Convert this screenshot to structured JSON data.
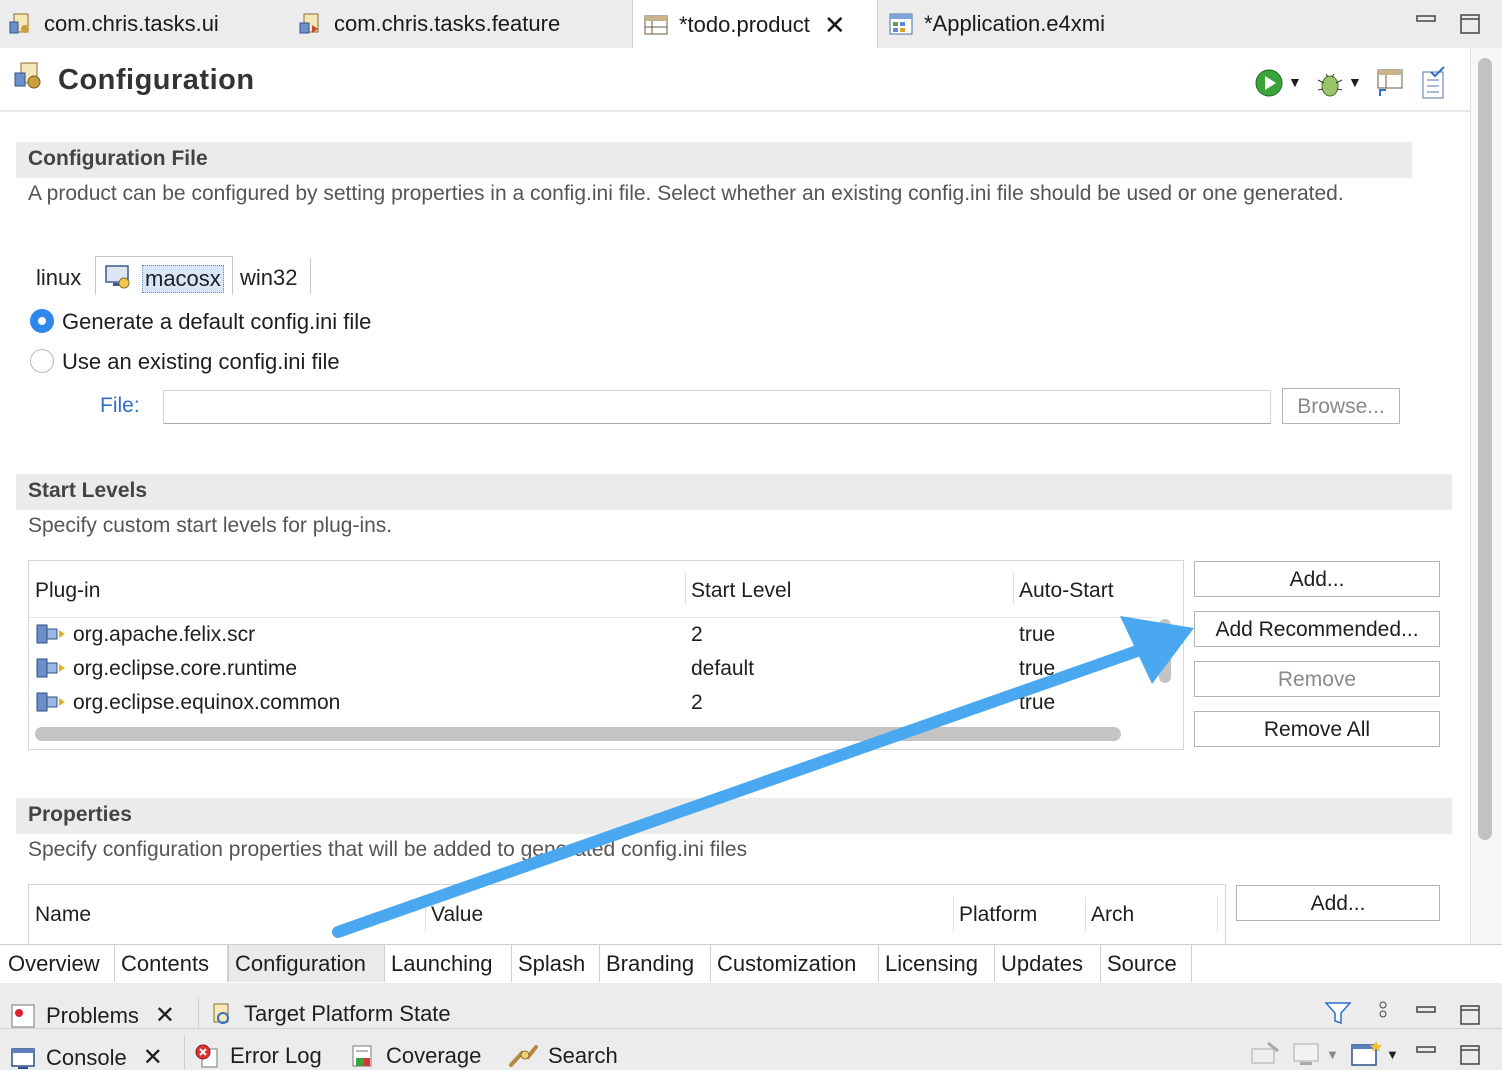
{
  "editor_tabs": [
    {
      "label": "com.chris.tasks.ui",
      "icon": "plugin-manifest-icon"
    },
    {
      "label": "com.chris.tasks.feature",
      "icon": "feature-icon"
    },
    {
      "label": "*todo.product",
      "icon": "product-icon",
      "active": true
    },
    {
      "label": "*Application.e4xmi",
      "icon": "model-editor-icon"
    }
  ],
  "page": {
    "title": "Configuration"
  },
  "config_file": {
    "title": "Configuration File",
    "description": "A product can be configured by setting properties in a config.ini file.  Select whether an existing config.ini file should be used or one generated.",
    "os_tabs": [
      "linux",
      "macosx",
      "win32"
    ],
    "selected_os": "macosx",
    "radio_generate": "Generate a default config.ini file",
    "radio_existing": "Use an existing config.ini file",
    "file_label": "File:",
    "file_value": "",
    "browse": "Browse..."
  },
  "start_levels": {
    "title": "Start Levels",
    "description": "Specify custom start levels for plug-ins.",
    "columns": [
      "Plug-in",
      "Start Level",
      "Auto-Start"
    ],
    "rows": [
      {
        "plugin": "org.apache.felix.scr",
        "level": "2",
        "auto": "true"
      },
      {
        "plugin": "org.eclipse.core.runtime",
        "level": "default",
        "auto": "true"
      },
      {
        "plugin": "org.eclipse.equinox.common",
        "level": "2",
        "auto": "true"
      }
    ],
    "buttons": {
      "add": "Add...",
      "add_recommended": "Add Recommended...",
      "remove": "Remove",
      "remove_all": "Remove All"
    }
  },
  "properties": {
    "title": "Properties",
    "description": "Specify configuration properties that will be added to generated config.ini files",
    "columns": [
      "Name",
      "Value",
      "Platform",
      "Arch"
    ],
    "buttons": {
      "add": "Add..."
    }
  },
  "page_tabs": [
    "Overview",
    "Contents",
    "Configuration",
    "Launching",
    "Splash",
    "Branding",
    "Customization",
    "Licensing",
    "Updates",
    "Source"
  ],
  "active_page_tab": "Configuration",
  "views_row1": [
    "Problems",
    "Target Platform State"
  ],
  "views_row2": [
    "Console",
    "Error Log",
    "Coverage",
    "Search"
  ],
  "colors": {
    "accent": "#2e87ec",
    "annotation_arrow": "#4aa8f0",
    "link_blue": "#2f6fc9"
  }
}
